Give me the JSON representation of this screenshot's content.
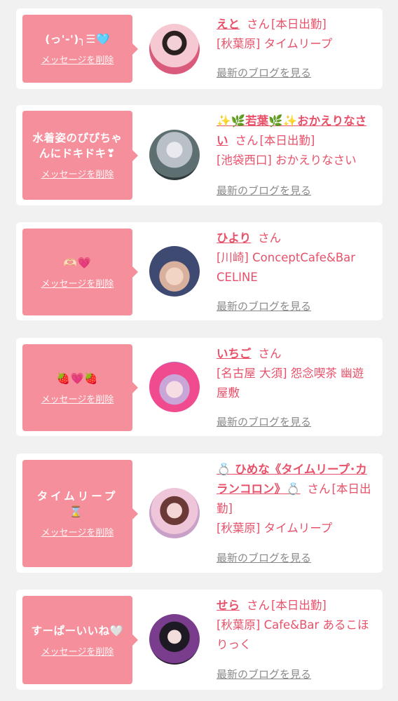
{
  "cards": [
    {
      "message": "(っ'-')╮☰🩵",
      "delete_label": "メッセージを削除",
      "name": "えと",
      "suffix": "さん",
      "line1_tail": "[本日出勤]",
      "info_lines": [
        "[秋葉原] タイムリープ"
      ],
      "blog_label": "最新のブログを見る"
    },
    {
      "message": "水着姿のぴぴちゃんにドキドキ❣",
      "delete_label": "メッセージを削除",
      "name": "✨🌿若葉🌿✨おかえりなさい",
      "suffix": "さん",
      "line1_tail": "[本日出勤]",
      "info_lines": [
        "[池袋西口] おかえりなさい"
      ],
      "blog_label": "最新のブログを見る"
    },
    {
      "message": "🫶🏻💗",
      "delete_label": "メッセージを削除",
      "name": "ひより",
      "suffix": "さん",
      "line1_tail": "",
      "info_lines": [
        "[川崎] ConceptCafe&Bar CELINE"
      ],
      "blog_label": "最新のブログを見る"
    },
    {
      "message": "🍓💗🍓",
      "delete_label": "メッセージを削除",
      "name": "いちご",
      "suffix": "さん",
      "line1_tail": "",
      "info_lines": [
        "[名古屋 大須] 怨念喫茶 幽遊屋敷"
      ],
      "blog_label": "最新のブログを見る"
    },
    {
      "message": "タイムリープ⌛",
      "delete_label": "メッセージを削除",
      "name": "💍 ひめな《タイムリープ･カランコロン》💍",
      "suffix": "さん",
      "line1_tail": "[本日出勤]",
      "info_lines": [
        "[秋葉原] タイムリープ"
      ],
      "blog_label": "最新のブログを見る"
    },
    {
      "message": "すーぱーいいね🤍",
      "delete_label": "メッセージを削除",
      "name": "せら",
      "suffix": "さん",
      "line1_tail": "[本日出勤]",
      "info_lines": [
        "[秋葉原] Cafe&Bar あるこほりっく"
      ],
      "blog_label": "最新のブログを見る"
    }
  ],
  "colors": {
    "accent": "#e8516a",
    "bubble": "#f68f9c",
    "link_gray": "#8a8a8a",
    "background": "#f1f1f1"
  }
}
